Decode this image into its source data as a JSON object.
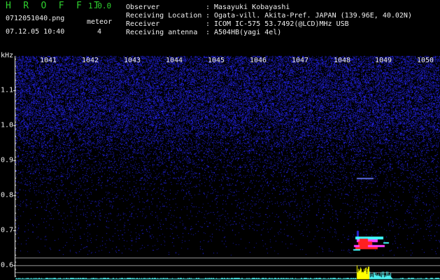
{
  "header": {
    "app_name": "H R O F F T",
    "version": "1.0.0",
    "filename": "0712051040.png",
    "event_label": "meteor",
    "datetime": "07.12.05 10:40",
    "event_count": "4"
  },
  "metadata": [
    {
      "key": "Observer",
      "value": "Masayuki Kobayashi"
    },
    {
      "key": "Receiving Location",
      "value": "Ogata-vill. Akita-Pref. JAPAN (139.96E, 40.02N)"
    },
    {
      "key": "Receiver",
      "value": "ICOM IC-575 53.7492(@LCD)MHz USB"
    },
    {
      "key": "Receiving antenna",
      "value": "A504HB(yagi 4el)"
    }
  ],
  "spectrogram": {
    "y_unit": "kHz",
    "x_ticks": [
      "1041",
      "1042",
      "1043",
      "1044",
      "1045",
      "1046",
      "1047",
      "1048",
      "1049",
      "1050"
    ],
    "y_ticks": [
      "1.1",
      "1.0",
      "0.9",
      "0.8",
      "0.7",
      "0.6"
    ],
    "colors": {
      "background": "#000000",
      "noise": "#2a2ad8",
      "trace_red": "#ff2020",
      "trace_magenta": "#ff40ff",
      "trace_cyan": "#40ffff",
      "level_yellow": "#ffff00",
      "level_cyan": "#4ff0f0",
      "ref_lines": "#9a9a9a"
    }
  }
}
